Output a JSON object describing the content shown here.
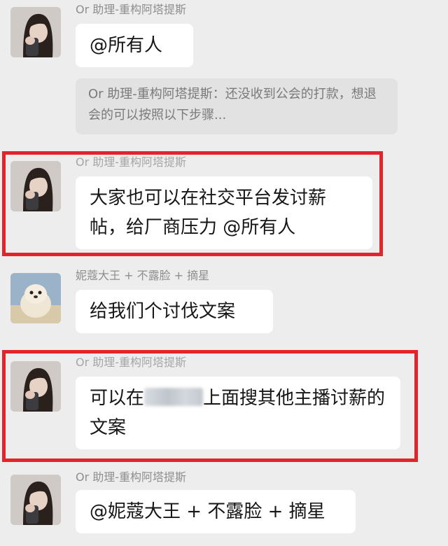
{
  "messages": [
    {
      "sender": "Or 助理-重构阿塔提斯",
      "text": "@所有人",
      "quote": "Or 助理-重构阿塔提斯：还没收到公会的打款，想退会的可以按照以下步骤...",
      "avatar": "girl-selfie-avatar"
    },
    {
      "sender": "Or 助理-重构阿塔提斯",
      "text": "大家也可以在社交平台发讨薪帖，给厂商压力 @所有人",
      "highlighted": true,
      "avatar": "girl-selfie-avatar"
    },
    {
      "sender": "妮蔻大王 + 不露脸 + 摘星",
      "text": "给我们个讨伐文案",
      "avatar": "seal-plush-avatar"
    },
    {
      "sender": "Or 助理-重构阿塔提斯",
      "text_before": "可以在",
      "text_after": "上面搜其他主播讨薪的文案",
      "redacted": true,
      "highlighted": true,
      "avatar": "girl-selfie-avatar"
    },
    {
      "sender": "Or 助理-重构阿塔提斯",
      "text": "@妮蔻大王 + 不露脸 + 摘星",
      "avatar": "girl-selfie-avatar"
    }
  ],
  "colors": {
    "background": "#ededed",
    "bubble": "#ffffff",
    "quote": "#e2e2e2",
    "highlight": "#e2252b",
    "sender": "#8e8e8e"
  }
}
